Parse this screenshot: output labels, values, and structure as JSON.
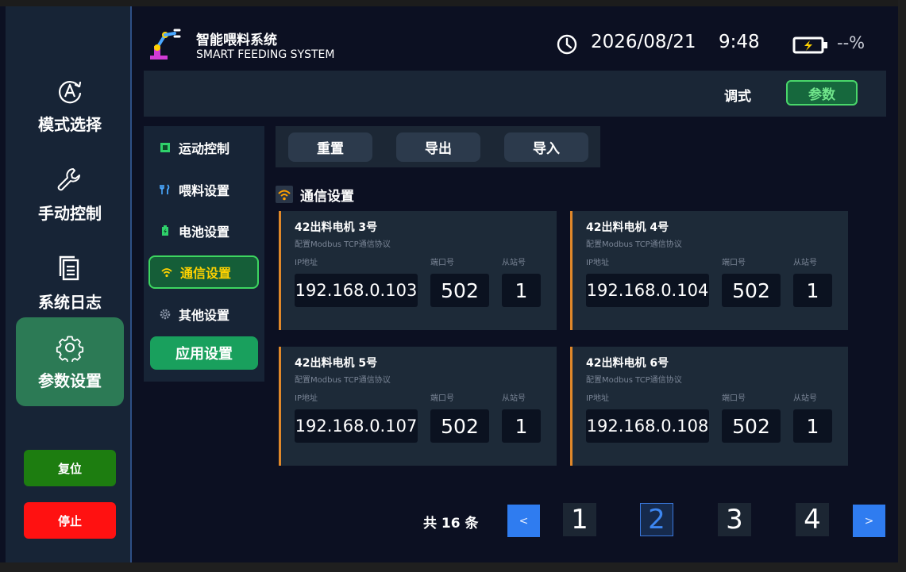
{
  "header": {
    "title_cn": "智能喂料系统",
    "title_en": "SMART FEEDING SYSTEM",
    "date": "2026/08/21",
    "time": "9:48",
    "battery": "--%",
    "icons": {
      "logo": "robot-arm-icon",
      "clock": "clock-icon",
      "battery": "battery-charging-icon"
    }
  },
  "sidebar": {
    "items": [
      {
        "label": "模式选择",
        "icon": "auto-mode-icon"
      },
      {
        "label": "手动控制",
        "icon": "wrench-icon"
      },
      {
        "label": "系统日志",
        "icon": "document-icon"
      },
      {
        "label": "参数设置",
        "icon": "gear-icon",
        "active": true
      }
    ],
    "reset": "复位",
    "stop": "停止"
  },
  "modebar": {
    "debug": "调式",
    "param": "参数"
  },
  "subnav": {
    "items": [
      {
        "label": "运动控制",
        "icon": "chip-icon"
      },
      {
        "label": "喂料设置",
        "icon": "fork-knife-icon"
      },
      {
        "label": "电池设置",
        "icon": "battery-icon"
      },
      {
        "label": "通信设置",
        "icon": "wifi-icon",
        "active": true
      },
      {
        "label": "其他设置",
        "icon": "gear-icon"
      }
    ],
    "apply": "应用设置"
  },
  "toolbar": {
    "reset": "重置",
    "export": "导出",
    "import": "导入"
  },
  "section": {
    "title": "通信设置",
    "icon": "wifi-icon"
  },
  "labels": {
    "desc": "配置Modbus TCP通信协议",
    "ip": "IP地址",
    "port": "端口号",
    "slave": "从站号"
  },
  "cards": [
    {
      "title": "42出料电机 3号",
      "ip": "192.168.0.103",
      "port": "502",
      "slave": "1"
    },
    {
      "title": "42出料电机 4号",
      "ip": "192.168.0.104",
      "port": "502",
      "slave": "1"
    },
    {
      "title": "42出料电机 5号",
      "ip": "192.168.0.107",
      "port": "502",
      "slave": "1"
    },
    {
      "title": "42出料电机 6号",
      "ip": "192.168.0.108",
      "port": "502",
      "slave": "1"
    }
  ],
  "pagination": {
    "total": "共 16 条",
    "prev": "<",
    "next": ">",
    "pages": [
      "1",
      "2",
      "3",
      "4"
    ],
    "current": "2"
  },
  "colors": {
    "accent_green": "#2c7a55",
    "active_border": "#3dd660",
    "active_text": "#ffd200",
    "card_accent": "#e0882a",
    "page_blue": "#2f7cf0",
    "stop_red": "#ff1111",
    "reset_green": "#1d7d10"
  }
}
